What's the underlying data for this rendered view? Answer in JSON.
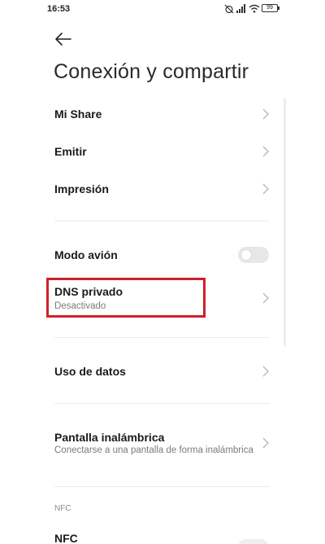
{
  "status_bar": {
    "time": "16:53",
    "battery": "99",
    "icons": [
      "alarm-off-icon",
      "signal-icon",
      "wifi-icon",
      "battery-icon"
    ]
  },
  "header": {
    "back_icon": "arrow-left-icon",
    "title": "Conexión y compartir"
  },
  "items": {
    "mi_share": {
      "label": "Mi Share"
    },
    "emitir": {
      "label": "Emitir"
    },
    "impresion": {
      "label": "Impresión"
    },
    "modo_avion": {
      "label": "Modo avión",
      "toggle_on": false
    },
    "dns_privado": {
      "label": "DNS privado",
      "sub": "Desactivado"
    },
    "uso_datos": {
      "label": "Uso de datos"
    },
    "pantalla": {
      "label": "Pantalla inalámbrica",
      "sub": "Conectarse a una pantalla de forma inalámbrica"
    },
    "nfc_section": "NFC",
    "nfc": {
      "label": "NFC"
    }
  },
  "colors": {
    "highlight": "#d0202a",
    "toggle_off": "#e7e7e7",
    "chevron": "#b8b8b8"
  }
}
